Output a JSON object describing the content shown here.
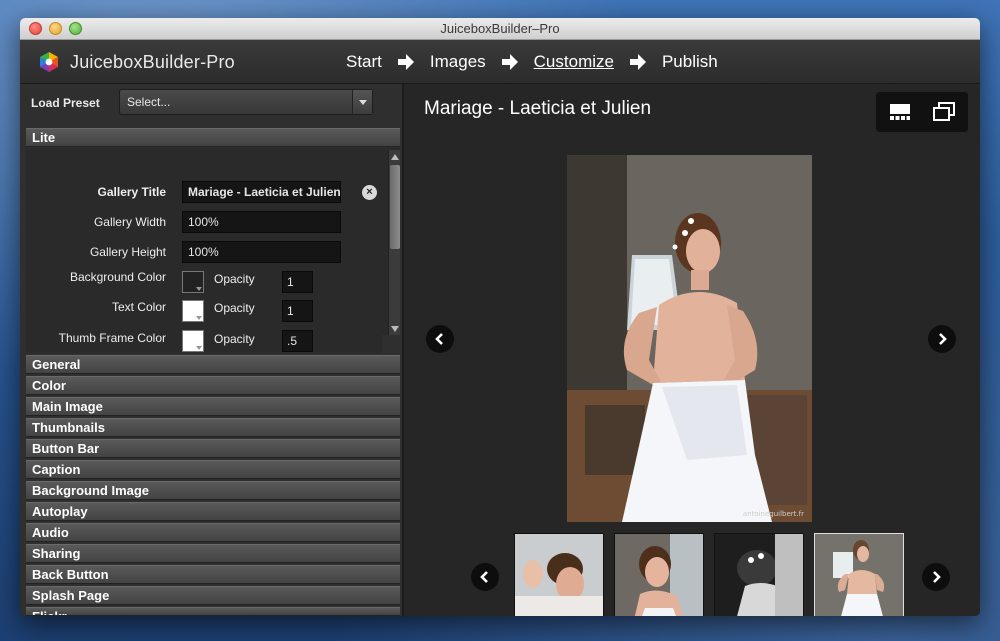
{
  "window": {
    "title": "JuiceboxBuilder–Pro"
  },
  "header": {
    "app_name": "JuiceboxBuilder-Pro",
    "steps": [
      {
        "label": "Start",
        "active": false
      },
      {
        "label": "Images",
        "active": false
      },
      {
        "label": "Customize",
        "active": true
      },
      {
        "label": "Publish",
        "active": false
      }
    ]
  },
  "left": {
    "preset": {
      "label": "Load Preset",
      "value": "Select..."
    },
    "open_section": "Lite",
    "fields": {
      "gallery_title": {
        "label": "Gallery Title",
        "value": "Mariage - Laeticia et Julien"
      },
      "gallery_width": {
        "label": "Gallery Width",
        "value": "100%"
      },
      "gallery_height": {
        "label": "Gallery Height",
        "value": "100%"
      },
      "background_color": {
        "label": "Background Color",
        "swatch": "#222222",
        "opacity_label": "Opacity",
        "opacity": "1"
      },
      "text_color": {
        "label": "Text Color",
        "swatch": "#ffffff",
        "opacity_label": "Opacity",
        "opacity": "1"
      },
      "thumb_frame_color": {
        "label": "Thumb Frame Color",
        "swatch": "#ffffff",
        "opacity_label": "Opacity",
        "opacity": ".5"
      }
    },
    "sections": [
      "General",
      "Color",
      "Main Image",
      "Thumbnails",
      "Button Bar",
      "Caption",
      "Background Image",
      "Autoplay",
      "Audio",
      "Sharing",
      "Back Button",
      "Splash Page",
      "Flickr"
    ]
  },
  "preview": {
    "title": "Mariage - Laeticia et Julien",
    "watermark": "antoineguilbert.fr",
    "thumbnail_count": 4,
    "selected_thumbnail": 4
  }
}
